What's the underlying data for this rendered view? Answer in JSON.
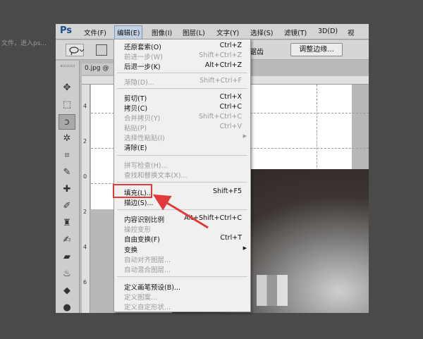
{
  "background": {
    "fade_text": "文件，进入ps..."
  },
  "menubar": {
    "logo": "Ps",
    "items": [
      {
        "label": "文件(F)"
      },
      {
        "label": "编辑(E)"
      },
      {
        "label": "图像(I)"
      },
      {
        "label": "图层(L)"
      },
      {
        "label": "文字(Y)"
      },
      {
        "label": "选择(S)"
      },
      {
        "label": "滤镜(T)"
      },
      {
        "label": "3D(D)"
      },
      {
        "label": "视"
      }
    ]
  },
  "options_bar": {
    "partial_text": "除锯齿",
    "refine_edge_label": "调整边缘..."
  },
  "document": {
    "tab_label": "0.jpg @"
  },
  "ruler": {
    "left_marks": [
      "4",
      "2",
      "0",
      "2",
      "4",
      "6"
    ]
  },
  "edit_menu": {
    "items": [
      {
        "label": "还原套索(O)",
        "shortcut": "Ctrl+Z",
        "enabled": true
      },
      {
        "label": "前进一步(W)",
        "shortcut": "Shift+Ctrl+Z",
        "enabled": false
      },
      {
        "label": "后退一步(K)",
        "shortcut": "Alt+Ctrl+Z",
        "enabled": true
      },
      {
        "label": "渐隐(D)...",
        "shortcut": "Shift+Ctrl+F",
        "enabled": false
      },
      {
        "label": "剪切(T)",
        "shortcut": "Ctrl+X",
        "enabled": true
      },
      {
        "label": "拷贝(C)",
        "shortcut": "Ctrl+C",
        "enabled": true
      },
      {
        "label": "合并拷贝(Y)",
        "shortcut": "Shift+Ctrl+C",
        "enabled": false
      },
      {
        "label": "粘贴(P)",
        "shortcut": "Ctrl+V",
        "enabled": false
      },
      {
        "label": "选择性粘贴(I)",
        "shortcut": "",
        "enabled": false
      },
      {
        "label": "清除(E)",
        "shortcut": "",
        "enabled": true
      },
      {
        "label": "拼写检查(H)...",
        "shortcut": "",
        "enabled": false
      },
      {
        "label": "查找和替换文本(X)...",
        "shortcut": "",
        "enabled": false
      },
      {
        "label": "填充(L)...",
        "shortcut": "Shift+F5",
        "enabled": true
      },
      {
        "label": "描边(S)...",
        "shortcut": "",
        "enabled": true
      },
      {
        "label": "内容识别比例",
        "shortcut": "Alt+Shift+Ctrl+C",
        "enabled": true
      },
      {
        "label": "操控变形",
        "shortcut": "",
        "enabled": false
      },
      {
        "label": "自由变换(F)",
        "shortcut": "Ctrl+T",
        "enabled": true
      },
      {
        "label": "变换",
        "shortcut": "",
        "enabled": true
      },
      {
        "label": "自动对齐图层...",
        "shortcut": "",
        "enabled": false
      },
      {
        "label": "自动混合图层...",
        "shortcut": "",
        "enabled": false
      },
      {
        "label": "定义画笔预设(B)...",
        "shortcut": "",
        "enabled": true
      },
      {
        "label": "定义图案...",
        "shortcut": "",
        "enabled": false
      },
      {
        "label": "定义自定形状...",
        "shortcut": "",
        "enabled": false
      }
    ]
  },
  "colors": {
    "highlight": "#e23a3a",
    "menu_active_bg": "#c4d2e6",
    "logo": "#1a4e8a"
  }
}
